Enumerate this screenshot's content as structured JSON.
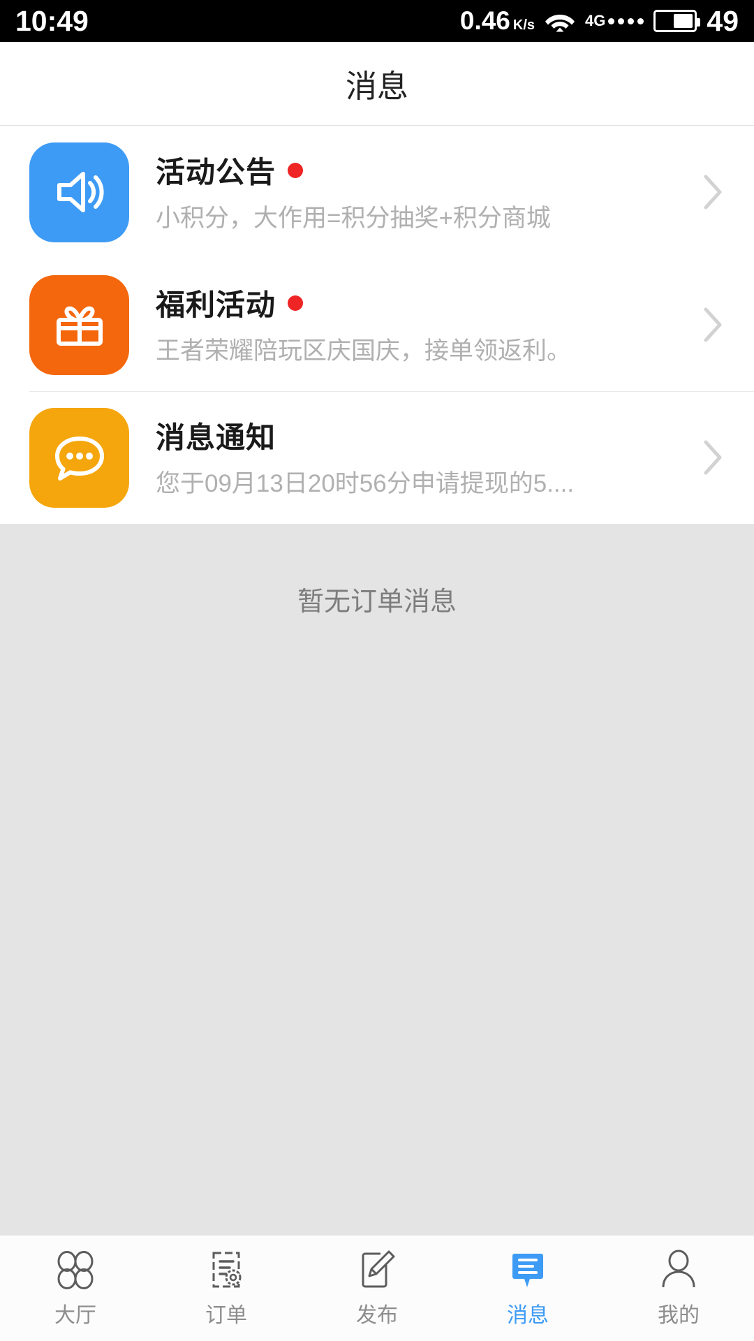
{
  "status_bar": {
    "clock": "10:49",
    "network_speed": "0.46",
    "speed_unit_top": "K",
    "speed_unit_bottom": "s",
    "wifi_icon": "wifi-icon",
    "mobile_network": "4G",
    "signal_dots": 4,
    "battery_percent": "49",
    "battery_level": 49
  },
  "header": {
    "title": "消息"
  },
  "messages": [
    {
      "icon": "speaker-announcement-icon",
      "icon_color": "#3d9bf5",
      "title": "活动公告",
      "unread": true,
      "subtitle": "小积分，大作用=积分抽奖+积分商城",
      "chevron": "chevron-right-icon"
    },
    {
      "icon": "gift-icon",
      "icon_color": "#f4670c",
      "title": "福利活动",
      "unread": true,
      "subtitle": "王者荣耀陪玩区庆国庆，接单领返利。",
      "chevron": "chevron-right-icon"
    },
    {
      "icon": "chat-bubble-dots-icon",
      "icon_color": "#f5a60d",
      "title": "消息通知",
      "unread": false,
      "subtitle": "您于09月13日20时56分申请提现的5....",
      "chevron": "chevron-right-icon"
    }
  ],
  "empty_state": {
    "text": "暂无订单消息"
  },
  "tabbar": {
    "active_color": "#3d9bf5",
    "inactive_color": "#8d8d8d",
    "items": [
      {
        "label": "大厅",
        "icon": "grid-four-circles-icon",
        "active": false
      },
      {
        "label": "订单",
        "icon": "order-document-icon",
        "active": false
      },
      {
        "label": "发布",
        "icon": "publish-pencil-icon",
        "active": false
      },
      {
        "label": "消息",
        "icon": "message-bubble-icon",
        "active": true
      },
      {
        "label": "我的",
        "icon": "user-profile-icon",
        "active": false
      }
    ]
  }
}
